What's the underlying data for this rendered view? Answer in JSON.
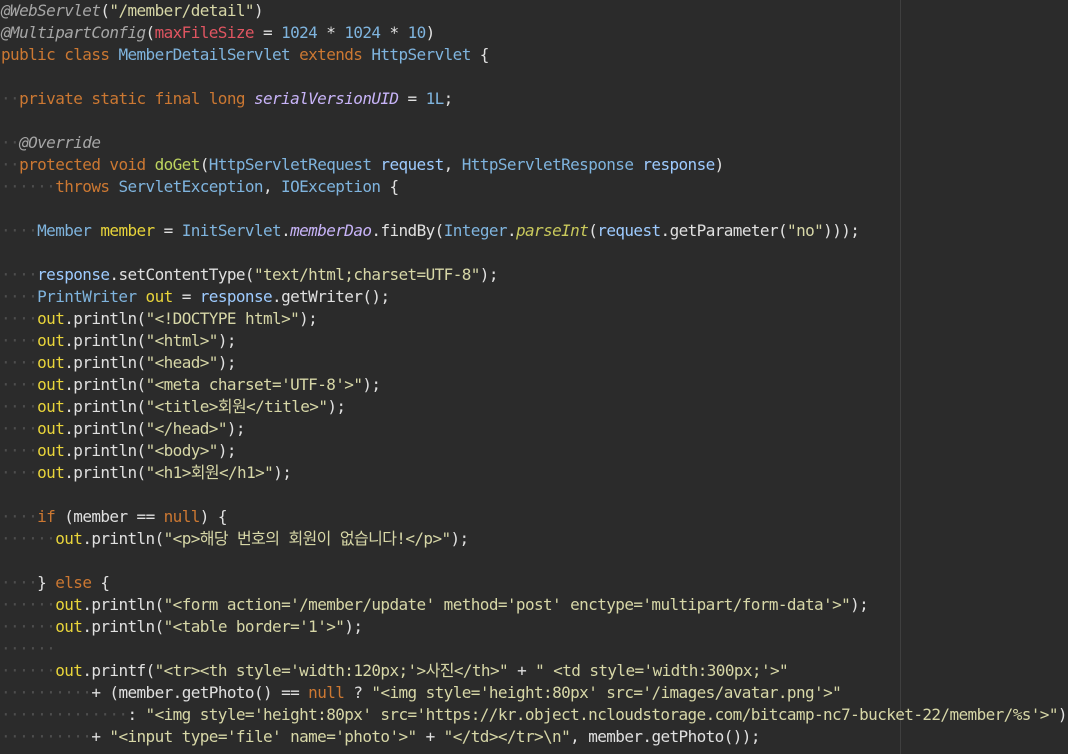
{
  "editor": {
    "lines": [
      [
        [
          "ann",
          "@WebServlet"
        ],
        [
          "plain",
          "("
        ],
        [
          "str",
          "\"/member/detail\""
        ],
        [
          "plain",
          ")"
        ]
      ],
      [
        [
          "ann",
          "@MultipartConfig"
        ],
        [
          "plain",
          "("
        ],
        [
          "prop",
          "maxFileSize"
        ],
        [
          "plain",
          " = "
        ],
        [
          "num",
          "1024"
        ],
        [
          "plain",
          " * "
        ],
        [
          "num",
          "1024"
        ],
        [
          "plain",
          " * "
        ],
        [
          "num",
          "10"
        ],
        [
          "plain",
          ")"
        ]
      ],
      [
        [
          "kw",
          "public class "
        ],
        [
          "type",
          "MemberDetailServlet"
        ],
        [
          "kw",
          " extends "
        ],
        [
          "type",
          "HttpServlet"
        ],
        [
          "plain",
          " {"
        ]
      ],
      [],
      [
        [
          "ws",
          "··"
        ],
        [
          "kw",
          "private static final long "
        ],
        [
          "ifield",
          "serialVersionUID"
        ],
        [
          "plain",
          " = "
        ],
        [
          "num",
          "1L"
        ],
        [
          "plain",
          ";"
        ]
      ],
      [],
      [
        [
          "ws",
          "··"
        ],
        [
          "ann",
          "@Override"
        ]
      ],
      [
        [
          "ws",
          "··"
        ],
        [
          "kw",
          "protected void "
        ],
        [
          "meth-decl",
          "doGet"
        ],
        [
          "plain",
          "("
        ],
        [
          "type",
          "HttpServletRequest"
        ],
        [
          "param",
          " request"
        ],
        [
          "plain",
          ", "
        ],
        [
          "type",
          "HttpServletResponse"
        ],
        [
          "param",
          " response"
        ],
        [
          "plain",
          ")"
        ]
      ],
      [
        [
          "ws",
          "······"
        ],
        [
          "kw",
          "throws "
        ],
        [
          "type",
          "ServletException"
        ],
        [
          "plain",
          ", "
        ],
        [
          "type",
          "IOException"
        ],
        [
          "plain",
          " {"
        ]
      ],
      [],
      [
        [
          "ws",
          "····"
        ],
        [
          "type",
          "Member"
        ],
        [
          "var",
          " member"
        ],
        [
          "plain",
          " = "
        ],
        [
          "type",
          "InitServlet"
        ],
        [
          "plain",
          "."
        ],
        [
          "ifield2",
          "memberDao"
        ],
        [
          "plain",
          "."
        ],
        [
          "method",
          "findBy"
        ],
        [
          "plain",
          "("
        ],
        [
          "type",
          "Integer"
        ],
        [
          "plain",
          "."
        ],
        [
          "smeth",
          "parseInt"
        ],
        [
          "plain",
          "("
        ],
        [
          "param",
          "request"
        ],
        [
          "plain",
          "."
        ],
        [
          "method",
          "getParameter"
        ],
        [
          "plain",
          "("
        ],
        [
          "str",
          "\"no\""
        ],
        [
          "plain",
          ")));"
        ]
      ],
      [],
      [
        [
          "ws",
          "····"
        ],
        [
          "param",
          "response"
        ],
        [
          "plain",
          "."
        ],
        [
          "method",
          "setContentType"
        ],
        [
          "plain",
          "("
        ],
        [
          "str",
          "\"text/html;charset=UTF-8\""
        ],
        [
          "plain",
          ");"
        ]
      ],
      [
        [
          "ws",
          "····"
        ],
        [
          "type",
          "PrintWriter"
        ],
        [
          "var",
          " out"
        ],
        [
          "plain",
          " = "
        ],
        [
          "param",
          "response"
        ],
        [
          "plain",
          "."
        ],
        [
          "method",
          "getWriter"
        ],
        [
          "plain",
          "();"
        ]
      ],
      [
        [
          "ws",
          "····"
        ],
        [
          "var",
          "out"
        ],
        [
          "plain",
          "."
        ],
        [
          "method",
          "println"
        ],
        [
          "plain",
          "("
        ],
        [
          "str",
          "\"<!DOCTYPE html>\""
        ],
        [
          "plain",
          ");"
        ]
      ],
      [
        [
          "ws",
          "····"
        ],
        [
          "var",
          "out"
        ],
        [
          "plain",
          "."
        ],
        [
          "method",
          "println"
        ],
        [
          "plain",
          "("
        ],
        [
          "str",
          "\"<html>\""
        ],
        [
          "plain",
          ");"
        ]
      ],
      [
        [
          "ws",
          "····"
        ],
        [
          "var",
          "out"
        ],
        [
          "plain",
          "."
        ],
        [
          "method",
          "println"
        ],
        [
          "plain",
          "("
        ],
        [
          "str",
          "\"<head>\""
        ],
        [
          "plain",
          ");"
        ]
      ],
      [
        [
          "ws",
          "····"
        ],
        [
          "var",
          "out"
        ],
        [
          "plain",
          "."
        ],
        [
          "method",
          "println"
        ],
        [
          "plain",
          "("
        ],
        [
          "str",
          "\"<meta charset='UTF-8'>\""
        ],
        [
          "plain",
          ");"
        ]
      ],
      [
        [
          "ws",
          "····"
        ],
        [
          "var",
          "out"
        ],
        [
          "plain",
          "."
        ],
        [
          "method",
          "println"
        ],
        [
          "plain",
          "("
        ],
        [
          "str",
          "\"<title>회원</title>\""
        ],
        [
          "plain",
          ");"
        ]
      ],
      [
        [
          "ws",
          "····"
        ],
        [
          "var",
          "out"
        ],
        [
          "plain",
          "."
        ],
        [
          "method",
          "println"
        ],
        [
          "plain",
          "("
        ],
        [
          "str",
          "\"</head>\""
        ],
        [
          "plain",
          ");"
        ]
      ],
      [
        [
          "ws",
          "····"
        ],
        [
          "var",
          "out"
        ],
        [
          "plain",
          "."
        ],
        [
          "method",
          "println"
        ],
        [
          "plain",
          "("
        ],
        [
          "str",
          "\"<body>\""
        ],
        [
          "plain",
          ");"
        ]
      ],
      [
        [
          "ws",
          "····"
        ],
        [
          "var",
          "out"
        ],
        [
          "plain",
          "."
        ],
        [
          "method",
          "println"
        ],
        [
          "plain",
          "("
        ],
        [
          "str",
          "\"<h1>회원</h1>\""
        ],
        [
          "plain",
          ");"
        ]
      ],
      [],
      [
        [
          "ws",
          "····"
        ],
        [
          "kw",
          "if"
        ],
        [
          "plain",
          " ("
        ],
        [
          "plain",
          "member"
        ],
        [
          "plain",
          " == "
        ],
        [
          "kw",
          "null"
        ],
        [
          "plain",
          ") {"
        ]
      ],
      [
        [
          "ws",
          "······"
        ],
        [
          "var",
          "out"
        ],
        [
          "plain",
          "."
        ],
        [
          "method",
          "println"
        ],
        [
          "plain",
          "("
        ],
        [
          "str",
          "\"<p>해당 번호의 회원이 없습니다!</p>\""
        ],
        [
          "plain",
          ");"
        ]
      ],
      [],
      [
        [
          "ws",
          "····"
        ],
        [
          "plain",
          "} "
        ],
        [
          "kw",
          "else"
        ],
        [
          "plain",
          " {"
        ]
      ],
      [
        [
          "ws",
          "······"
        ],
        [
          "var",
          "out"
        ],
        [
          "plain",
          "."
        ],
        [
          "method",
          "println"
        ],
        [
          "plain",
          "("
        ],
        [
          "str",
          "\"<form action='/member/update' method='post' enctype='multipart/form-data'>\""
        ],
        [
          "plain",
          ");"
        ]
      ],
      [
        [
          "ws",
          "······"
        ],
        [
          "var",
          "out"
        ],
        [
          "plain",
          "."
        ],
        [
          "method",
          "println"
        ],
        [
          "plain",
          "("
        ],
        [
          "str",
          "\"<table border='1'>\""
        ],
        [
          "plain",
          ");"
        ]
      ],
      [
        [
          "ws",
          "······"
        ]
      ],
      [
        [
          "ws",
          "······"
        ],
        [
          "var",
          "out"
        ],
        [
          "plain",
          "."
        ],
        [
          "method",
          "printf"
        ],
        [
          "plain",
          "("
        ],
        [
          "str",
          "\"<tr><th style='width:120px;'>사진</th>\""
        ],
        [
          "plain",
          " + "
        ],
        [
          "str",
          "\" <td style='width:300px;'>\""
        ]
      ],
      [
        [
          "ws",
          "··········"
        ],
        [
          "plain",
          "+ ("
        ],
        [
          "plain",
          "member"
        ],
        [
          "plain",
          "."
        ],
        [
          "method",
          "getPhoto"
        ],
        [
          "plain",
          "() == "
        ],
        [
          "kw",
          "null"
        ],
        [
          "plain",
          " ? "
        ],
        [
          "str",
          "\"<img style='height:80px' src='/images/avatar.png'>\""
        ]
      ],
      [
        [
          "ws",
          "··············"
        ],
        [
          "plain",
          ": "
        ],
        [
          "str",
          "\"<img style='height:80px' src='https://kr.object.ncloudstorage.com/bitcamp-nc7-bucket-22/member/%s'>\""
        ],
        [
          "plain",
          ")"
        ]
      ],
      [
        [
          "ws",
          "··········"
        ],
        [
          "plain",
          "+ "
        ],
        [
          "str",
          "\"<input type='file' name='photo'>\""
        ],
        [
          "plain",
          " + "
        ],
        [
          "str",
          "\"</td></tr>\\n\""
        ],
        [
          "plain",
          ", "
        ],
        [
          "plain",
          "member"
        ],
        [
          "plain",
          "."
        ],
        [
          "method",
          "getPhoto"
        ],
        [
          "plain",
          "());"
        ]
      ]
    ]
  }
}
